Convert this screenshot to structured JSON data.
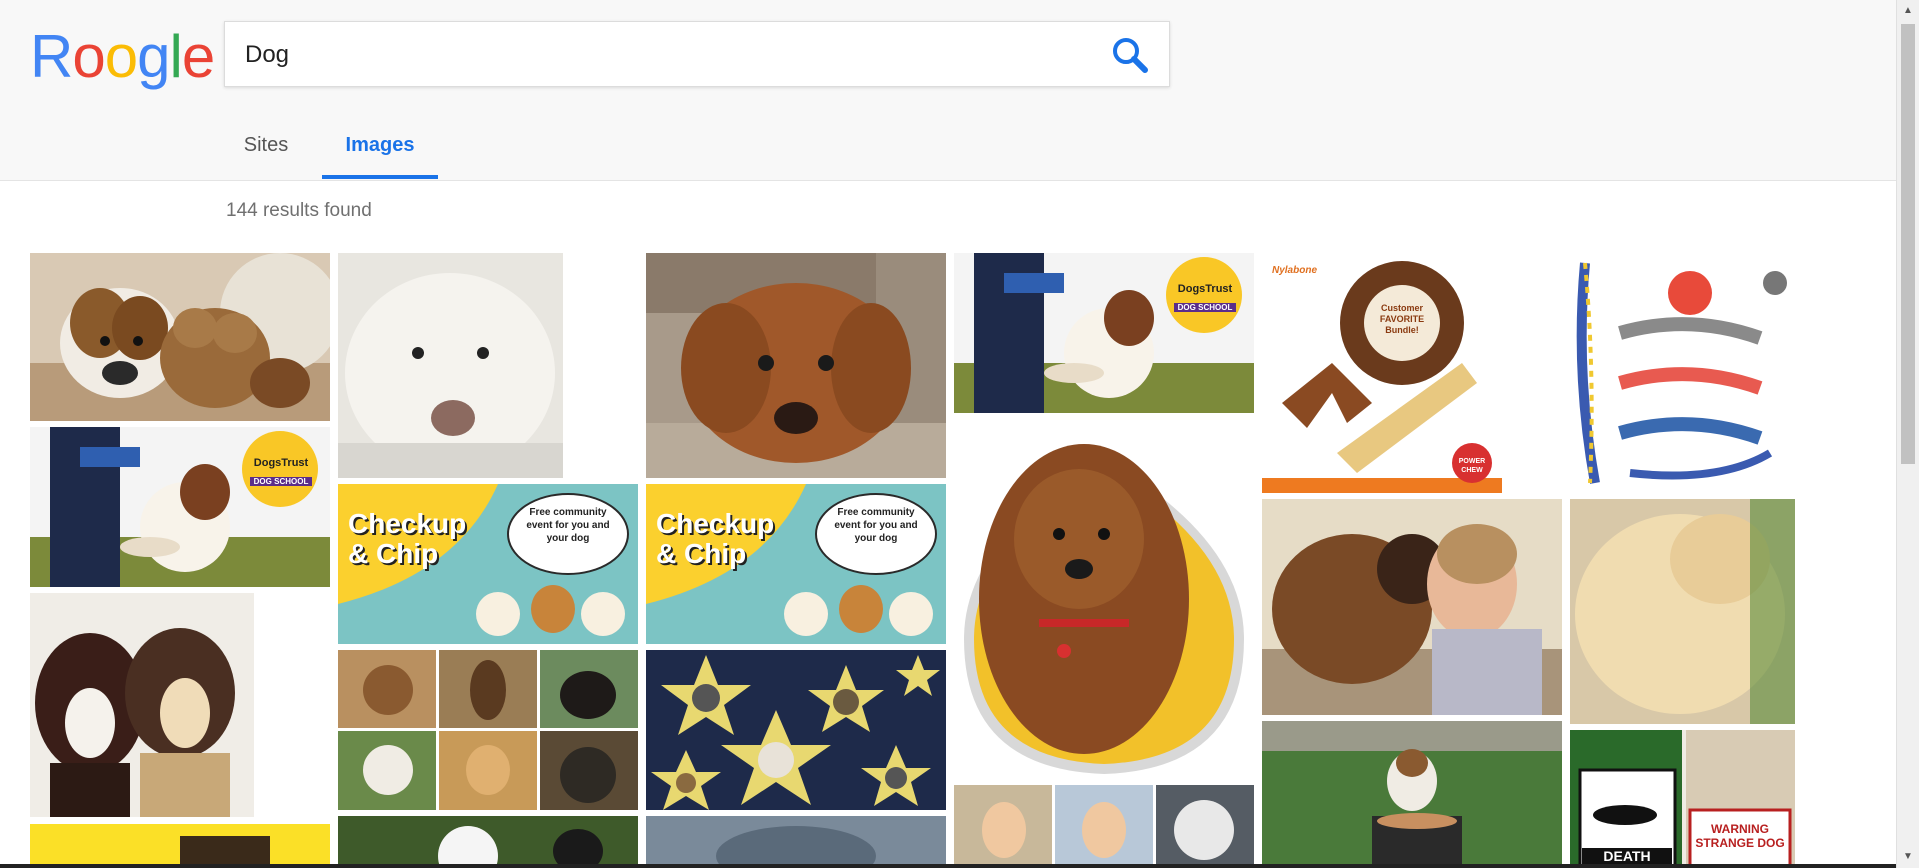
{
  "app": {
    "logo_letters": [
      "R",
      "o",
      "o",
      "g",
      "l",
      "e"
    ],
    "logo_colors": [
      "#4285F4",
      "#EA4335",
      "#FBBC05",
      "#4285F4",
      "#34A853",
      "#EA4335"
    ]
  },
  "search": {
    "query": "Dog",
    "icon": "search-icon",
    "icon_color": "#1a73e8"
  },
  "tabs": [
    {
      "label": "Sites",
      "active": false
    },
    {
      "label": "Images",
      "active": true
    }
  ],
  "results": {
    "count_text": "144 results found"
  },
  "images": [
    {
      "name": "jack-russell-with-toy",
      "desc": ""
    },
    {
      "name": "white-labrador"
    },
    {
      "name": "brown-dog-lying"
    },
    {
      "name": "dogs-trust-handshake-1",
      "badge_top": "DogsTrust",
      "badge_bottom": "DOG SCHOOL"
    },
    {
      "name": "nylabone-bundle",
      "brand": "Nylabone",
      "badge": "Customer FAVORITE Bundle!",
      "stamp": "POWER CHEW"
    },
    {
      "name": "rope-toys"
    },
    {
      "name": "dogs-trust-handshake-2",
      "badge_top": "DogsTrust",
      "badge_bottom": "DOG SCHOOL"
    },
    {
      "name": "checkup-chip-1",
      "title": "Checkup & Chip",
      "bubble": "Free community event for you and your dog"
    },
    {
      "name": "checkup-chip-2",
      "title": "Checkup & Chip",
      "bubble": "Free community event for you and your dog"
    },
    {
      "name": "labradoodle-badge"
    },
    {
      "name": "man-with-mastiff"
    },
    {
      "name": "golden-puppy-sleeping"
    },
    {
      "name": "boston-terriers"
    },
    {
      "name": "dog-collage"
    },
    {
      "name": "star-dogs"
    },
    {
      "name": "dog-on-grass"
    },
    {
      "name": "warning-signs",
      "sign1": "DEATH",
      "sign2": "WARNING STRANGE DOG"
    },
    {
      "name": "kids-and-husky"
    },
    {
      "name": "yellow-banner"
    },
    {
      "name": "ghost-dog"
    },
    {
      "name": "blurry-dog"
    }
  ]
}
